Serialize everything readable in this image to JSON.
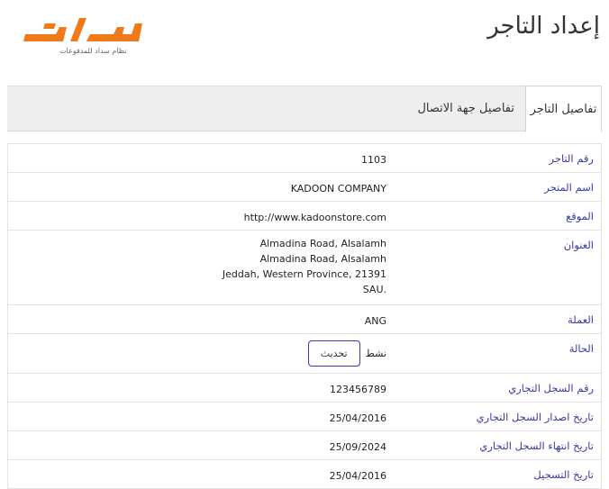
{
  "page_title": "إعداد التاجر",
  "logo": {
    "subtitle": "نظام سداد للمدفوعات",
    "color": "#f07a1a"
  },
  "tabs": [
    {
      "label": "تفاصيل التاجر",
      "active": true
    },
    {
      "label": "تفاصيل جهة الاتصال",
      "active": false
    }
  ],
  "details": {
    "merchant_id": {
      "label": "رقم التاجر",
      "value": "1103"
    },
    "store_name": {
      "label": "اسم المتجر",
      "value": "KADOON COMPANY"
    },
    "website": {
      "label": "الموقع",
      "value": "http://www.kadoonstore.com"
    },
    "address": {
      "label": "العنوان",
      "lines": [
        "Almadina Road, Alsalamh",
        "Almadina Road, Alsalamh",
        "Jeddah, Western Province, 21391",
        "SAU."
      ]
    },
    "currency": {
      "label": "العملة",
      "value": "ANG"
    },
    "status": {
      "label": "الحالة",
      "value": "نشط",
      "button": "تحديث"
    },
    "cr_number": {
      "label": "رقم السجل التجاري",
      "value": "123456789"
    },
    "cr_issue_date": {
      "label": "تاريخ اصدار السجل التجاري",
      "value": "25/04/2016"
    },
    "cr_expiry_date": {
      "label": "تاريخ انتهاء السجل التجاري",
      "value": "25/09/2024"
    },
    "registration_date": {
      "label": "تاريخ التسجيل",
      "value": "25/04/2016"
    }
  },
  "colors": {
    "label": "#3a3aa8",
    "tab_bar": "#eeeeee",
    "border": "#e2e2e2"
  }
}
